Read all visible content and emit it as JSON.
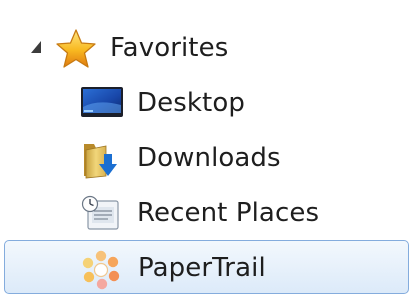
{
  "nav": {
    "group": {
      "label": "Favorites",
      "icon": "star-icon",
      "expander_icon": "expanded-triangle-icon",
      "expanded": true
    },
    "items": [
      {
        "label": "Desktop",
        "icon": "desktop-icon"
      },
      {
        "label": "Downloads",
        "icon": "downloads-folder-icon"
      },
      {
        "label": "Recent Places",
        "icon": "recent-places-icon"
      },
      {
        "label": "PaperTrail",
        "icon": "papertrail-icon",
        "selected": true
      }
    ]
  },
  "colors": {
    "selection_border": "#84acdd",
    "selection_fill_top": "#f3f8fd",
    "selection_fill_bottom": "#dceaf9",
    "star_fill": "#f8b820",
    "text": "#1e1e1e"
  }
}
